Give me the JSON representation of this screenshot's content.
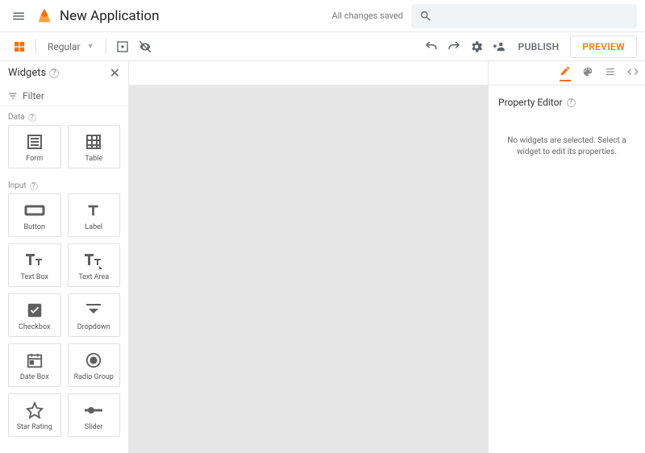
{
  "header": {
    "app_title": "New Application",
    "save_status": "All changes saved",
    "search_placeholder": ""
  },
  "toolbar": {
    "zoom_label": "Regular",
    "publish_label": "PUBLISH",
    "preview_label": "PREVIEW"
  },
  "widgets_panel": {
    "title": "Widgets",
    "filter_label": "Filter",
    "sections": {
      "data": {
        "label": "Data",
        "items": [
          "Form",
          "Table"
        ]
      },
      "input": {
        "label": "Input",
        "items": [
          "Button",
          "Label",
          "Text Box",
          "Text Area",
          "Checkbox",
          "Dropdown",
          "Date Box",
          "Radio Group",
          "Star Rating",
          "Slider"
        ]
      }
    }
  },
  "right_panel": {
    "tabs": [
      "edit",
      "palette",
      "text",
      "code"
    ],
    "active_tab": "edit",
    "property_editor_title": "Property Editor",
    "empty_message": "No widgets are selected. Select a widget to edit its properties."
  }
}
